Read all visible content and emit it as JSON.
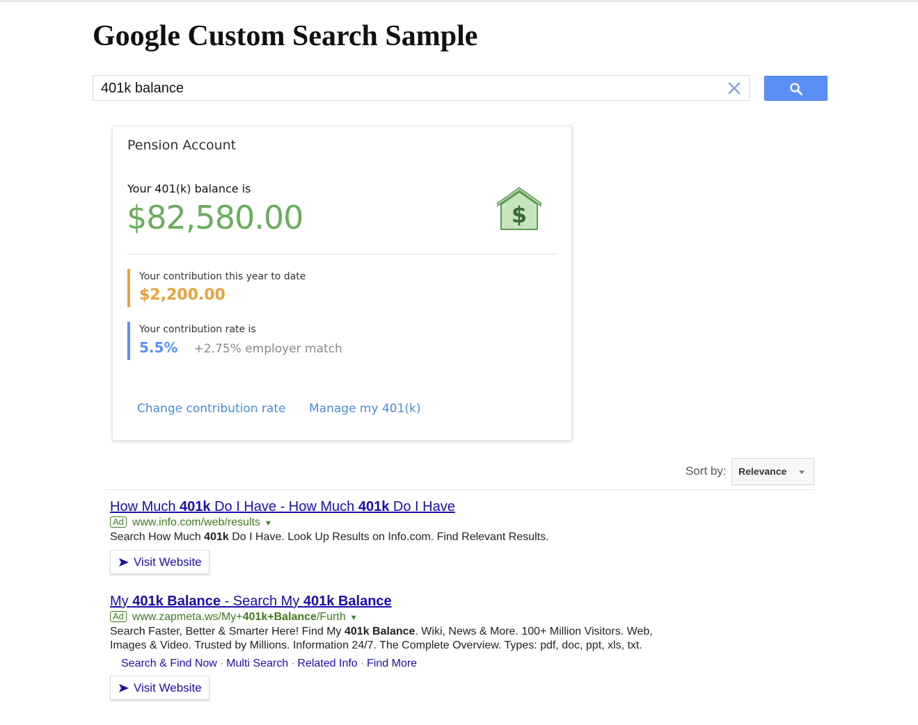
{
  "page": {
    "title": "Google Custom Search Sample"
  },
  "search": {
    "query": "401k balance"
  },
  "card": {
    "title": "Pension Account",
    "balance_label": "Your 401(k) balance is",
    "balance_value": "$82,580.00",
    "contribution_label": "Your contribution this year to date",
    "contribution_value": "$2,200.00",
    "rate_label": "Your contribution rate is",
    "rate_value": "5.5%",
    "rate_extra": "+2.75% employer match",
    "link_change": "Change contribution rate",
    "link_manage": "Manage my 401(k)"
  },
  "sort": {
    "label": "Sort by:",
    "value": "Relevance"
  },
  "ad_badge": "Ad",
  "visit_label": "Visit Website",
  "results": [
    {
      "title_parts": [
        "How Much ",
        "401k",
        " Do I Have - How Much ",
        "401k",
        " Do I Have"
      ],
      "url_parts": [
        "www.info.com/web/results"
      ],
      "desc_parts": [
        "Search How Much ",
        "401k",
        " Do I Have. Look Up Results on Info.com. Find Relevant Results."
      ]
    },
    {
      "title_parts": [
        "My ",
        "401k Balance",
        " - Search My ",
        "401k Balance"
      ],
      "url_parts": [
        "www.zapmeta.ws/My+",
        "401k",
        "+",
        "Balance",
        "/Furth"
      ],
      "desc_parts": [
        "Search Faster, Better & Smarter Here! Find My ",
        "401k Balance",
        ". Wiki, News & More. 100+ Million Visitors. Web, Images & Video. Trusted by Millions. Information 24/7. The Complete Overview. Types: pdf, doc, ppt, xls, txt."
      ],
      "sitelinks": [
        "Search & Find Now",
        "Multi Search",
        "Related Info",
        "Find More"
      ]
    }
  ],
  "colors": {
    "balance_green": "#6aae5c",
    "contribution_orange": "#e6a23c",
    "rate_blue": "#5a8ff5",
    "link_blue": "#1a0dab",
    "url_green": "#3c7a1e"
  }
}
